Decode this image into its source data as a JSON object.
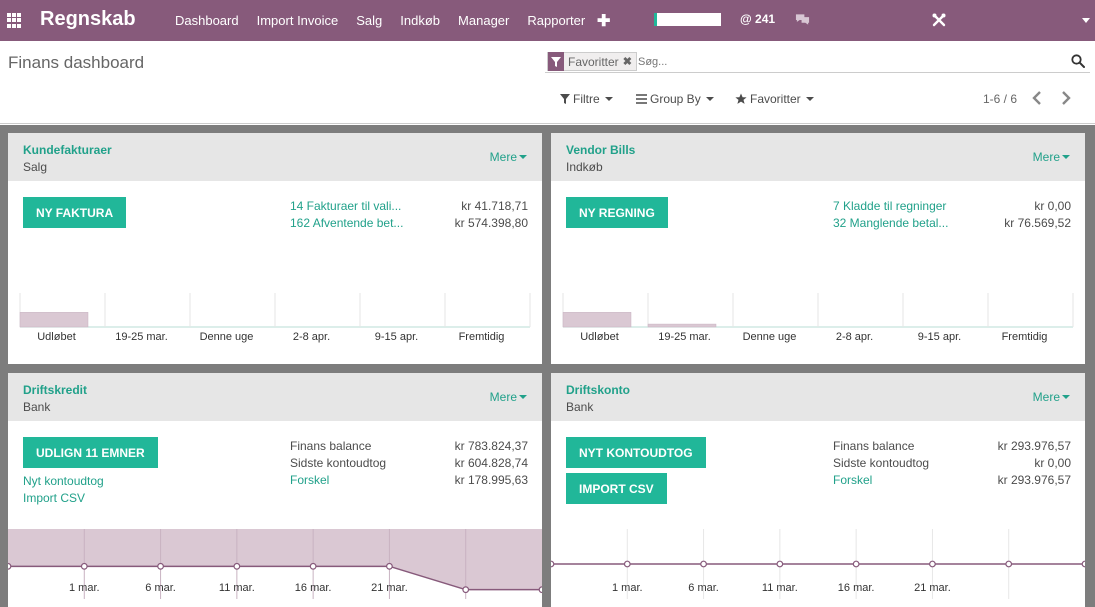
{
  "app": {
    "brand": "Regnskab",
    "menu": [
      "Dashboard",
      "Import Invoice",
      "Salg",
      "Indkøb",
      "Manager",
      "Rapporter"
    ],
    "mentions_count": "@ 241",
    "colors": {
      "topbar": "#875a7b",
      "accent": "#21b799",
      "link": "#21a18a"
    }
  },
  "control_panel": {
    "title": "Finans dashboard",
    "search": {
      "facet_label": "Favoritter",
      "placeholder": "Søg..."
    },
    "filters_label": "Filtre",
    "groupby_label": "Group By",
    "favorites_label": "Favoritter",
    "pager": "1-6 / 6"
  },
  "cards": {
    "sales": {
      "title": "Kundefakturaer",
      "subtitle": "Salg",
      "more": "Mere",
      "button": "NY FAKTURA",
      "stats": [
        {
          "label": "14 Fakturaer til vali...",
          "value": "kr 41.718,71"
        },
        {
          "label": "162 Afventende bet...",
          "value": "kr 574.398,80"
        }
      ],
      "chart_data": {
        "type": "bar",
        "categories": [
          "Udløbet",
          "19-25 mar.",
          "Denne uge",
          "2-8 apr.",
          "9-15 apr.",
          "Fremtidig"
        ],
        "values": [
          1,
          0,
          0,
          0,
          0,
          0
        ],
        "ylim": [
          0,
          3
        ]
      }
    },
    "vendor": {
      "title": "Vendor Bills",
      "subtitle": "Indkøb",
      "more": "Mere",
      "button": "NY REGNING",
      "stats": [
        {
          "label": "7 Kladde til regninger",
          "value": "kr 0,00"
        },
        {
          "label": "32 Manglende betal...",
          "value": "kr 76.569,52"
        }
      ],
      "chart_data": {
        "type": "bar",
        "categories": [
          "Udløbet",
          "19-25 mar.",
          "Denne uge",
          "2-8 apr.",
          "9-15 apr.",
          "Fremtidig"
        ],
        "values": [
          1,
          0.2,
          0,
          0,
          0,
          0
        ],
        "ylim": [
          0,
          3
        ]
      }
    },
    "bank": {
      "title": "Driftskredit",
      "subtitle": "Bank",
      "more": "Mere",
      "button": "UDLIGN 11 EMNER",
      "links": [
        "Nyt kontoudtog",
        "Import CSV"
      ],
      "stats": [
        {
          "label": "Finans balance",
          "value": "kr  783.824,37",
          "link": false
        },
        {
          "label": "Sidste kontoudtog",
          "value": "kr  604.828,74",
          "link": false
        },
        {
          "label": "Forskel",
          "value": "kr 178.995,63",
          "link": true
        }
      ],
      "chart_data": {
        "type": "area",
        "x": [
          "1 mar.",
          "6 mar.",
          "11 mar.",
          "16 mar.",
          "21 mar."
        ],
        "values": [
          0.2,
          0.2,
          0.2,
          0.2,
          0.2,
          0.2,
          -0.3,
          -0.3
        ],
        "ylim": [
          -0.5,
          1
        ]
      }
    },
    "account": {
      "title": "Driftskonto",
      "subtitle": "Bank",
      "more": "Mere",
      "buttons": [
        "NYT KONTOUDTOG",
        "IMPORT CSV"
      ],
      "stats": [
        {
          "label": "Finans balance",
          "value": "kr  293.976,57",
          "link": false
        },
        {
          "label": "Sidste kontoudtog",
          "value": "kr 0,00",
          "link": false
        },
        {
          "label": "Forskel",
          "value": "kr 293.976,57",
          "link": true
        }
      ],
      "chart_data": {
        "type": "line",
        "x": [
          "1 mar.",
          "6 mar.",
          "11 mar.",
          "16 mar.",
          "21 mar."
        ],
        "values": [
          0,
          0,
          0,
          0,
          0,
          0,
          0,
          0
        ],
        "ylim": [
          -1,
          1
        ]
      }
    }
  }
}
